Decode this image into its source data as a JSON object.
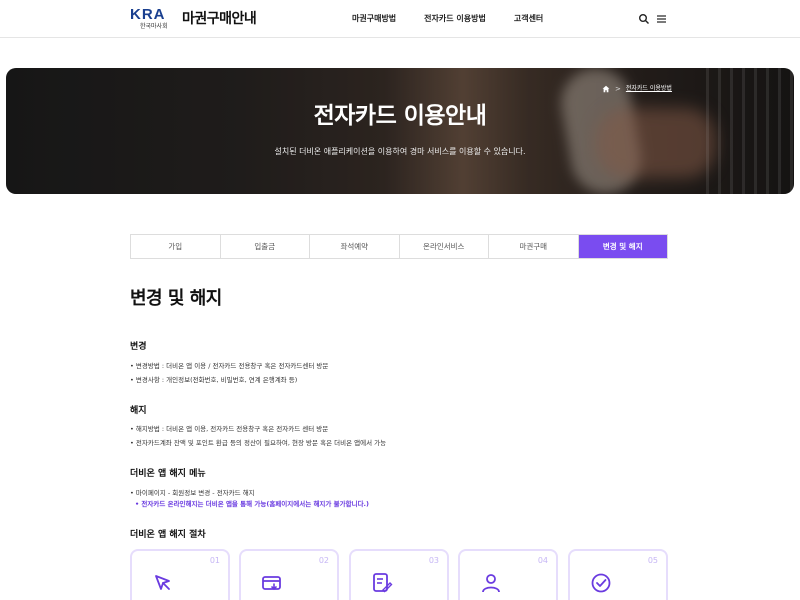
{
  "header": {
    "logo_mark": "KRA",
    "logo_sub": "한국마사회",
    "site_title": "마권구매안내",
    "nav": [
      "마권구매방법",
      "전자카드 이용방법",
      "고객센터"
    ],
    "search_icon": "search-icon",
    "menu_icon": "hamburger-menu-icon"
  },
  "hero": {
    "title": "전자카드 이용안내",
    "description": "설치된 더비온 애플리케이션을 이용하여 경마 서비스를 이용할 수 있습니다.",
    "breadcrumb": {
      "home_icon": "home-icon",
      "separator": ">",
      "current": "전자카드 이용방법"
    }
  },
  "tabs": {
    "items": [
      "가입",
      "입출금",
      "좌석예약",
      "온라인서비스",
      "마권구매",
      "변경 및 해지"
    ],
    "active_index": 5
  },
  "content": {
    "page_title": "변경 및 해지",
    "sections": {
      "change": {
        "title": "변경",
        "items": [
          "• 변경방법 : 더비온 앱 이용 / 전자카드 전용창구 혹은 전자카드센터 방문",
          "• 변경사항 : 개인정보(전화번호, 비밀번호, 연계 은행계좌 등)"
        ]
      },
      "cancel": {
        "title": "해지",
        "items": [
          "• 해지방법 : 더비온 앱 이용, 전자카드 전용창구 혹은 전자카드 센터 방문",
          "• 전자카드계좌 잔액 및 포인트 환급 등의 정산이 필요하여, 현장 방문 혹은 더비온 앱에서 가능"
        ]
      },
      "app_menu": {
        "title": "더비온 앱 해지 메뉴",
        "items": [
          "• 마이페이지 - 회원정보 변경 - 전자카드 해지"
        ],
        "note": "• 전자카드 온라인해지는 더비온 앱을 통해 가능(홈페이지에서는 해지가 불가합니다.)"
      },
      "procedure": {
        "title": "더비온 앱 해지 절차",
        "steps": [
          {
            "num": "01",
            "icon": "cursor-click-icon"
          },
          {
            "num": "02",
            "icon": "card-download-icon"
          },
          {
            "num": "03",
            "icon": "document-edit-icon"
          },
          {
            "num": "04",
            "icon": "user-icon"
          },
          {
            "num": "05",
            "icon": "check-circle-icon"
          }
        ]
      }
    }
  },
  "colors": {
    "accent": "#7a4cf0",
    "note": "#6a3be0",
    "step_border": "#e6ddfc"
  }
}
